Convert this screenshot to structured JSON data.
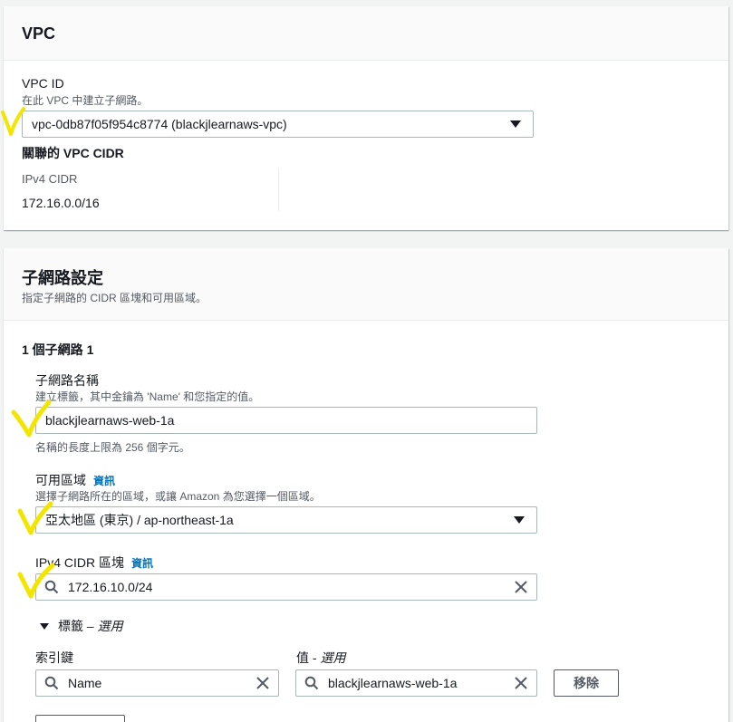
{
  "vpc_panel": {
    "title": "VPC",
    "vpc_id_label": "VPC ID",
    "vpc_id_desc": "在此 VPC 中建立子網路。",
    "vpc_id_value": "vpc-0db87f05f954c8774 (blackjlearnaws-vpc)",
    "cidr_heading": "關聯的 VPC CIDR",
    "ipv4_label": "IPv4 CIDR",
    "ipv4_value": "172.16.0.0/16"
  },
  "subnet_panel": {
    "title": "子網路設定",
    "desc": "指定子網路的 CIDR 區塊和可用區域。",
    "subnet_heading": "1 個子網路 1",
    "name_label": "子網路名稱",
    "name_desc": "建立標籤，其中金鑰為 'Name' 和您指定的值。",
    "name_value": "blackjlearnaws-web-1a",
    "name_hint": "名稱的長度上限為 256 個字元。",
    "az_label": "可用區域",
    "az_info": "資訊",
    "az_desc": "選擇子網路所在的區域，或讓 Amazon 為您選擇一個區域。",
    "az_value": "亞太地區 (東京) / ap-northeast-1a",
    "cidr_label": "IPv4 CIDR 區塊",
    "cidr_info": "資訊",
    "cidr_value": "172.16.10.0/24",
    "tags_toggle": "標籤",
    "tags_toggle_optional": "– 選用",
    "tag_key_label": "索引鍵",
    "tag_value_label": "值 - ",
    "tag_value_optional": "選用",
    "tag_key": "Name",
    "tag_value": "blackjlearnaws-web-1a",
    "remove_button": "移除"
  },
  "colors": {
    "annotation": "#f2e600",
    "link": "#0073bb",
    "border": "#aab7b8"
  }
}
